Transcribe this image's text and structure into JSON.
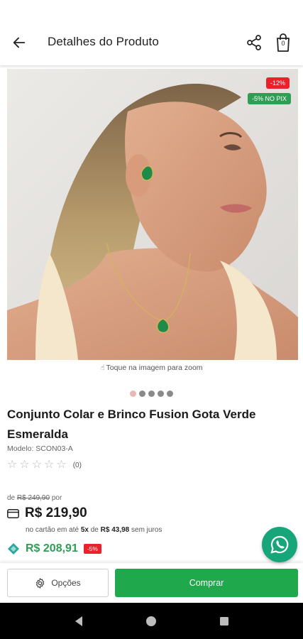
{
  "header": {
    "title": "Detalhes do Produto",
    "bag_count": "0"
  },
  "image": {
    "discount_badge": "-12%",
    "pix_badge": "-5% NO PIX",
    "zoom_hint": "Toque na imagem para zoom",
    "carousel_total": 5,
    "carousel_active": 0
  },
  "product": {
    "title": "Conjunto Colar e Brinco Fusion Gota Verde Esmeralda",
    "model": "Modelo: SCON03-A",
    "rating_count": "(0)",
    "rating_stars": 0
  },
  "pricing": {
    "old_prefix": "de",
    "old_price": "R$ 249,90",
    "old_suffix": "por",
    "card_price": "R$ 219,90",
    "installments_prefix": "no cartão em até",
    "installments_count": "5x",
    "installments_mid": "de",
    "installment_value": "R$ 43,98",
    "installments_suffix": "sem juros",
    "pix_price": "R$ 208,91",
    "pix_discount": "-5%"
  },
  "bottom": {
    "options_label": "Opções",
    "buy_label": "Comprar"
  },
  "colors": {
    "buy_green": "#1fa94c",
    "pix_green": "#2e9e55",
    "discount_red": "#e8212b",
    "whatsapp_green": "#17a67a"
  }
}
